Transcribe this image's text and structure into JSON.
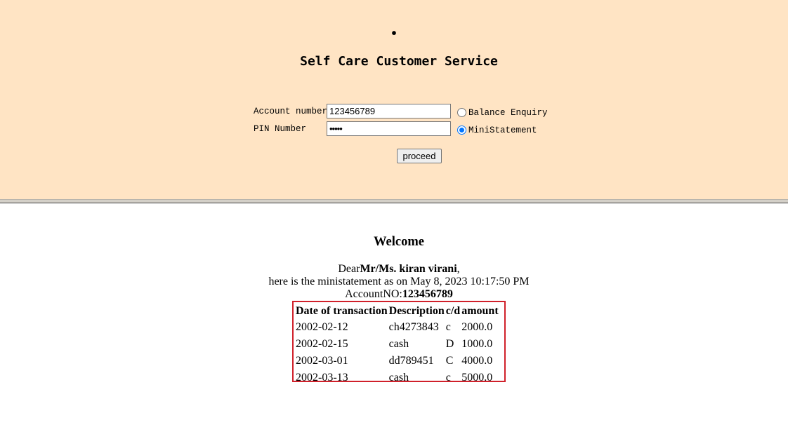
{
  "header": {
    "dot": "•",
    "title": "Self Care Customer Service"
  },
  "form": {
    "account_label": "Account number",
    "account_value": "123456789",
    "pin_label": "PIN Number",
    "pin_value": "•••••",
    "options": [
      {
        "label": "Balance Enquiry",
        "checked": false
      },
      {
        "label": "MiniStatement",
        "checked": true
      }
    ],
    "proceed_label": "proceed"
  },
  "result": {
    "welcome": "Welcome",
    "dear_prefix": "Dear",
    "customer_name": "Mr/Ms. kiran virani",
    "dear_suffix": ",",
    "statement_line": "here is the ministatement as on May 8, 2023 10:17:50 PM",
    "account_prefix": "AccountNO:",
    "account_number": "123456789",
    "table": {
      "headers": [
        "Date of transaction",
        "Description",
        "c/d",
        "amount"
      ],
      "rows": [
        [
          "2002-02-12",
          "ch4273843",
          "c",
          "2000.0"
        ],
        [
          "2002-02-15",
          "cash",
          "D",
          "1000.0"
        ],
        [
          "2002-03-01",
          "dd789451",
          "C",
          "4000.0"
        ],
        [
          "2002-03-13",
          "cash",
          "c",
          "5000.0"
        ]
      ]
    }
  },
  "colors": {
    "top_frame_bg": "#ffe4c4",
    "highlight_border": "#d0202a",
    "radio_checked": "#0075ff"
  }
}
